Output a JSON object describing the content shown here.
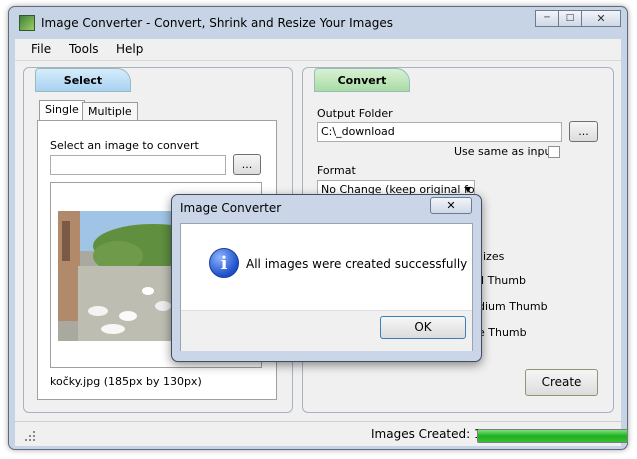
{
  "window": {
    "title": "Image Converter - Convert, Shrink and Resize Your Images",
    "icon": "app-icon"
  },
  "menu": [
    "File",
    "Tools",
    "Help"
  ],
  "select_panel": {
    "header": "Select",
    "tabs": [
      "Single",
      "Multiple"
    ],
    "active_tab": "Single",
    "prompt": "Select an image to convert",
    "path_value": "",
    "browse_label": "...",
    "caption": "kočky.jpg (185px by 130px)"
  },
  "convert_panel": {
    "header": "Convert",
    "output_folder_label": "Output Folder",
    "output_folder_value": "C:\\_download",
    "browse_label": "...",
    "use_same_as_input_label": "Use same as input",
    "use_same_as_input_checked": false,
    "format_label": "Format",
    "format_value": "No Change (keep original for",
    "partial_labels": [
      "izes",
      "ll Thumb",
      "dium Thumb",
      "e Thumb"
    ],
    "create_label": "Create"
  },
  "status": {
    "images_created_label": "Images Created: 1",
    "progress_fraction": 1.0,
    "progress_color": "#1fb01f"
  },
  "dialog": {
    "title": "Image Converter",
    "message": "All images were created successfully",
    "ok_label": "OK",
    "close_glyph": "✕",
    "icon": "info-icon"
  },
  "colors": {
    "select_header": "#a8d2f2",
    "convert_header": "#a9dca4",
    "window_frame": "#c7d4e6"
  }
}
